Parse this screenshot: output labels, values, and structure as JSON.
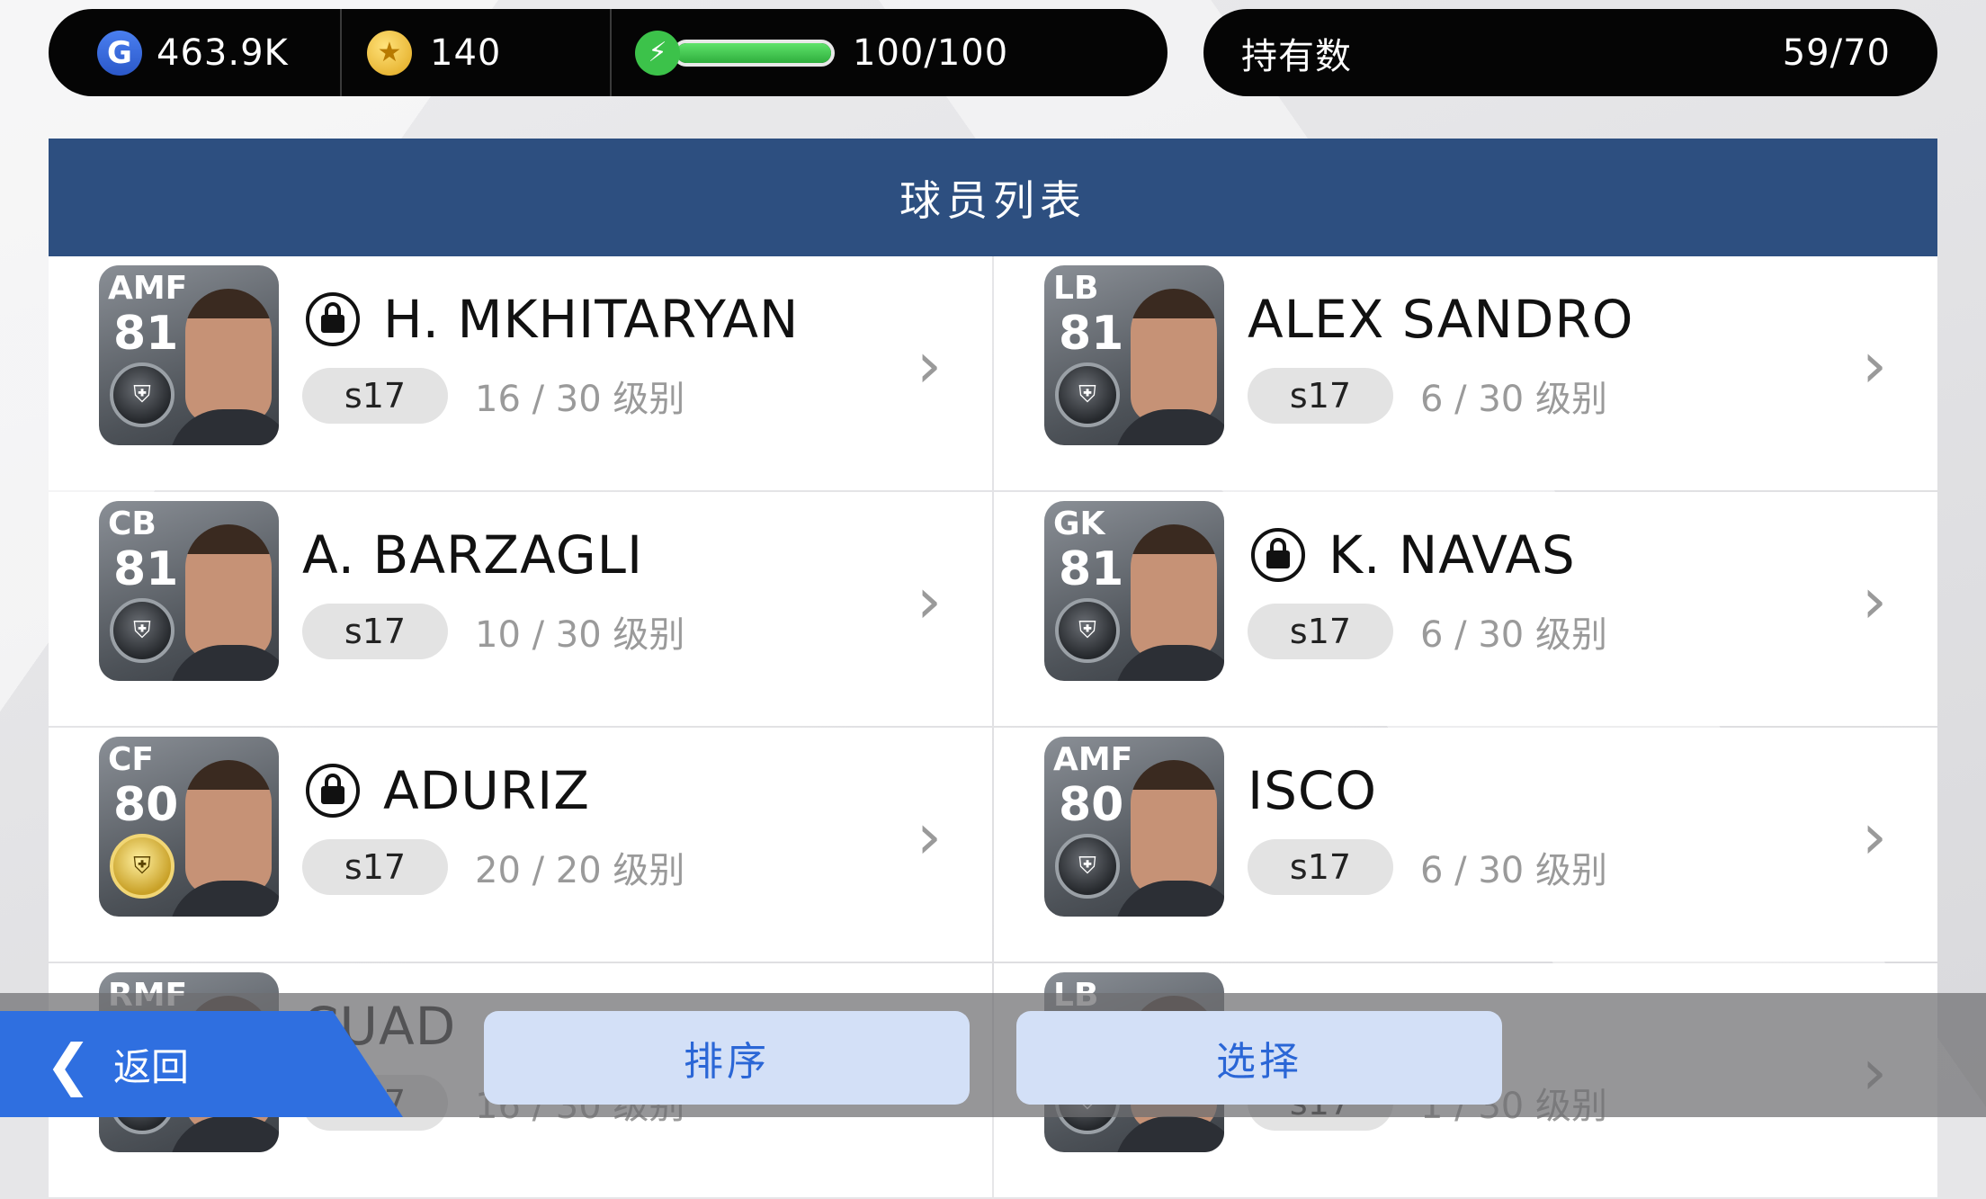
{
  "currency": {
    "gp": "463.9K",
    "coins": "140",
    "energy": "100/100",
    "energy_fraction": 1.0
  },
  "owned": {
    "label": "持有数",
    "value": "59/70"
  },
  "header": {
    "title": "球员列表"
  },
  "players": [
    {
      "pos": "AMF",
      "ovr": "81",
      "name": "H. MKHITARYAN",
      "locked": true,
      "tag": "s17",
      "level": "16 / 30 级别",
      "badge": "silver"
    },
    {
      "pos": "LB",
      "ovr": "81",
      "name": "ALEX SANDRO",
      "locked": false,
      "tag": "s17",
      "level": "6 / 30 级别",
      "badge": "silver"
    },
    {
      "pos": "CB",
      "ovr": "81",
      "name": "A. BARZAGLI",
      "locked": false,
      "tag": "s17",
      "level": "10 / 30 级别",
      "badge": "silver"
    },
    {
      "pos": "GK",
      "ovr": "81",
      "name": "K. NAVAS",
      "locked": true,
      "tag": "s17",
      "level": "6 / 30 级别",
      "badge": "silver"
    },
    {
      "pos": "CF",
      "ovr": "80",
      "name": "ADURIZ",
      "locked": true,
      "tag": "s17",
      "level": "20 / 20 级别",
      "badge": "gold"
    },
    {
      "pos": "AMF",
      "ovr": "80",
      "name": "ISCO",
      "locked": false,
      "tag": "s17",
      "level": "6 / 30 级别",
      "badge": "silver"
    },
    {
      "pos": "RMF",
      "ovr": "",
      "name": "CUAD",
      "locked": false,
      "tag": "s17",
      "level": "16 / 30 级别",
      "badge": "silver"
    },
    {
      "pos": "LB",
      "ovr": "",
      "name": "",
      "locked": false,
      "tag": "s17",
      "level": "1 / 30 级别",
      "badge": "silver"
    }
  ],
  "bottom": {
    "back_label": "返回",
    "sort_label": "排序",
    "select_label": "选择"
  },
  "icons": {
    "gp": "g-currency-icon",
    "coin": "star-coin-icon",
    "energy": "lightning-icon",
    "lock": "lock-icon",
    "chevron": "chevron-right-icon",
    "back": "chevron-left-icon"
  },
  "colors": {
    "header_blue": "#2d4f80",
    "back_blue": "#2f6fe0",
    "button_bg": "#d3e0f7",
    "energy_green": "#3cc24a"
  }
}
